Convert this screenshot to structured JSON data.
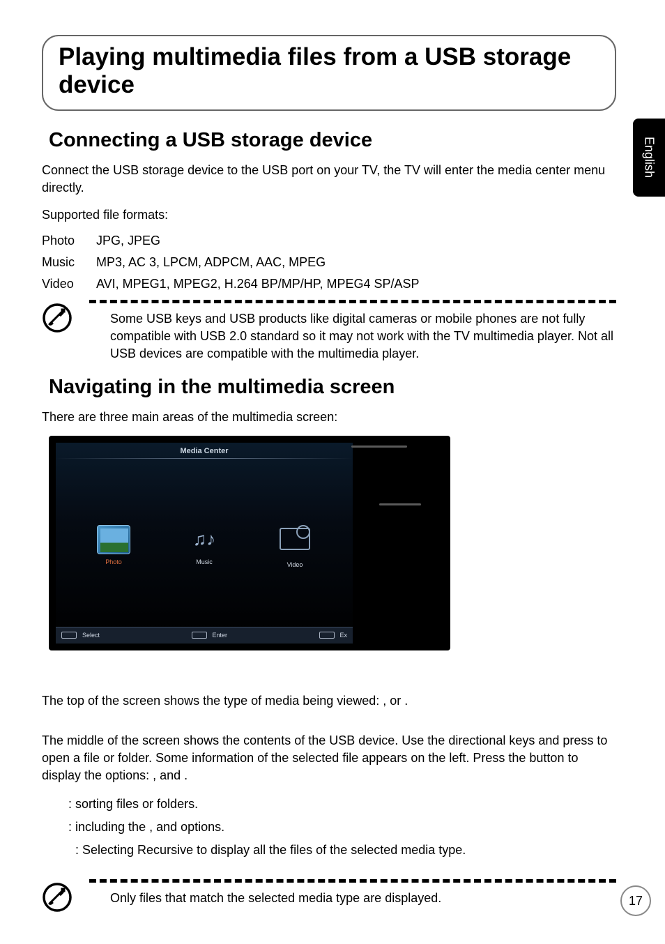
{
  "side_tab": "English",
  "page_number": "17",
  "title": "Playing multimedia files from a USB storage device",
  "section_connect": {
    "heading": "Connecting a USB storage device",
    "intro": "Connect the USB storage device to the USB port on your TV, the TV will enter the media center menu directly.",
    "supported_label": "Supported file formats:",
    "formats": [
      {
        "label": "Photo",
        "value": "JPG, JPEG"
      },
      {
        "label": "Music",
        "value": "MP3, AC 3, LPCM, ADPCM, AAC, MPEG"
      },
      {
        "label": "Video",
        "value": "AVI, MPEG1, MPEG2, H.264 BP/MP/HP, MPEG4 SP/ASP"
      }
    ],
    "note": "Some USB keys and USB products like digital cameras or mobile phones are not fully compatible with USB 2.0 standard so it may not work with the TV multimedia player. Not all USB devices are compatible with the multimedia player."
  },
  "section_nav": {
    "heading": "Navigating in the multimedia screen",
    "intro": "There are three main areas of the multimedia screen:",
    "tv_ui": {
      "title": "Media Center",
      "items": [
        "Photo",
        "Music",
        "Video"
      ],
      "footer_select": "Select",
      "footer_enter": "Enter",
      "footer_exit": "Ex"
    },
    "p_top": "The top of the screen shows the type of media being viewed:          ,          or          .",
    "p_middle": "The middle of the screen shows the contents of the USB device. Use the directional keys and press        to open a file or folder. Some information of the selected file appears on the left. Press the            button to display the options:        ,        and          .",
    "bullets": [
      ": sorting files or folders.",
      ": including the          ,          and             options.",
      ": Selecting Recursive to display all the files of the selected media type."
    ],
    "note": "Only files that match the selected media type are displayed."
  }
}
